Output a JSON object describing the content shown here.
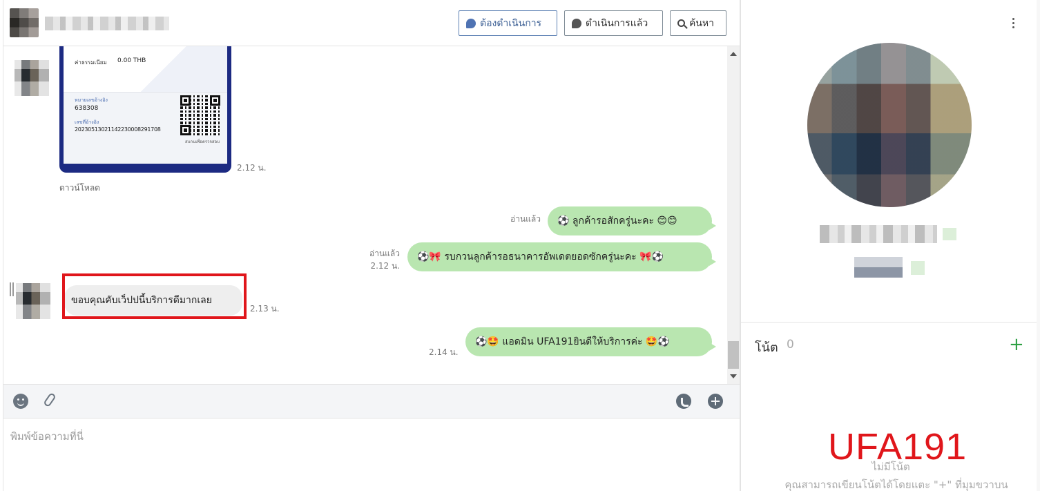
{
  "header": {
    "todo_label": "ต้องดำเนินการ",
    "done_label": "ดำเนินการแล้ว",
    "search_label": "ค้นหา"
  },
  "receipt": {
    "fee_label": "ค่าธรรมเนียม",
    "fee_value": "0.00 THB",
    "ref1_label": "หมายเลขอ้างอิง",
    "ref1_value": "638308",
    "ref2_label": "เลขที่อ้างอิง",
    "ref2_value": "20230513021142230008291708",
    "qr_note": "สแกนเพื่อตรวจสอบ"
  },
  "messages": {
    "receipt_time": "2.12 น.",
    "download_label": "ดาวน์โหลด",
    "out1_read": "อ่านแล้ว",
    "out1_text": "⚽ ลูกค้ารอสักครู่นะคะ 😊😊",
    "out2_read": "อ่านแล้ว",
    "out2_time": "2.12 น.",
    "out2_text": "⚽🎀 รบกวนลูกค้ารอธนาคารอัพเดตยอดซักครู่นะคะ 🎀⚽",
    "in1_text": "ขอบคุณคับเว็ปปนี้บริการดีมากเลย",
    "in1_time": "2.13 น.",
    "out3_time": "2.14 น.",
    "out3_text": "⚽🤩 แอดมิน UFA191ยินดีให้บริการค่ะ 🤩⚽"
  },
  "composer": {
    "placeholder": "พิมพ์ข้อความที่นี่"
  },
  "profile": {
    "note_title": "โน้ต",
    "note_count": "0",
    "note_add": "+",
    "note_empty": "ไม่มีโน้ต",
    "note_hint": "คุณสามารถเขียนโน้ตได้โดยแตะ \"+\" ที่มุมขวาบน",
    "watermark": "UFA191"
  },
  "colors": {
    "accent": "#3c5f94",
    "bubble_out": "#b9e6b0",
    "bubble_in": "#eeeeee",
    "highlight": "#e0161b",
    "add_note": "#2ea043"
  },
  "icons": [
    "chat-bubble-icon",
    "check-chat-icon",
    "search-icon",
    "emoji-icon",
    "paperclip-icon",
    "phone-icon",
    "add-circle-icon",
    "more-vertical-icon"
  ]
}
